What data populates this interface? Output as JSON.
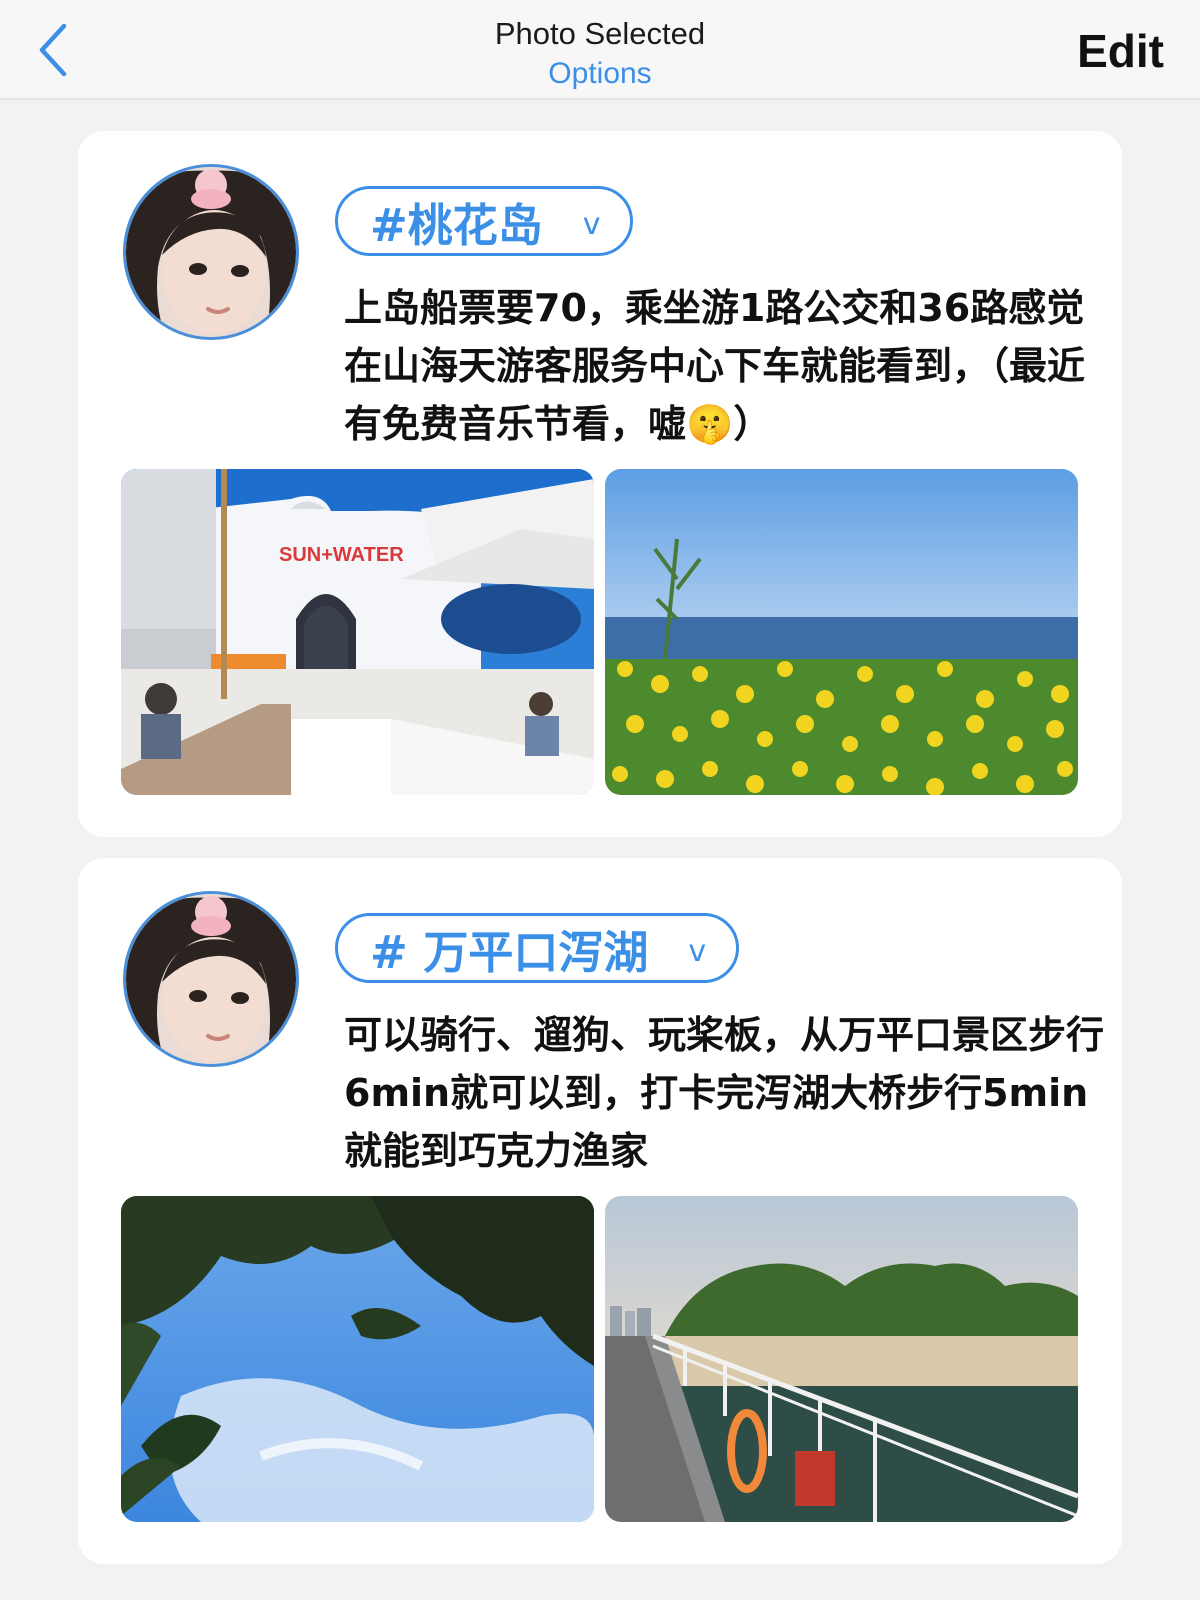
{
  "nav": {
    "title": "Photo Selected",
    "subtitle": "Options",
    "edit_label": "Edit",
    "back_icon": "chevron-left-icon",
    "accent_color": "#3b8fe6"
  },
  "posts": [
    {
      "tag": "#桃花岛",
      "tag_chevron": "v",
      "text": "上岛船票要70，乘坐游1路公交和36路感觉在山海天游客服务中心下车就能看到，（最近有免费音乐节看，嘘🤫）",
      "photos": [
        {
          "sign": "SUN+WATER"
        },
        {}
      ]
    },
    {
      "tag": "# 万平口泻湖",
      "tag_chevron": "v",
      "text": "可以骑行、遛狗、玩桨板，从万平口景区步行6min就可以到，打卡完泻湖大桥步行5min就能到巧克力渔家",
      "photos": [
        {},
        {}
      ]
    }
  ]
}
